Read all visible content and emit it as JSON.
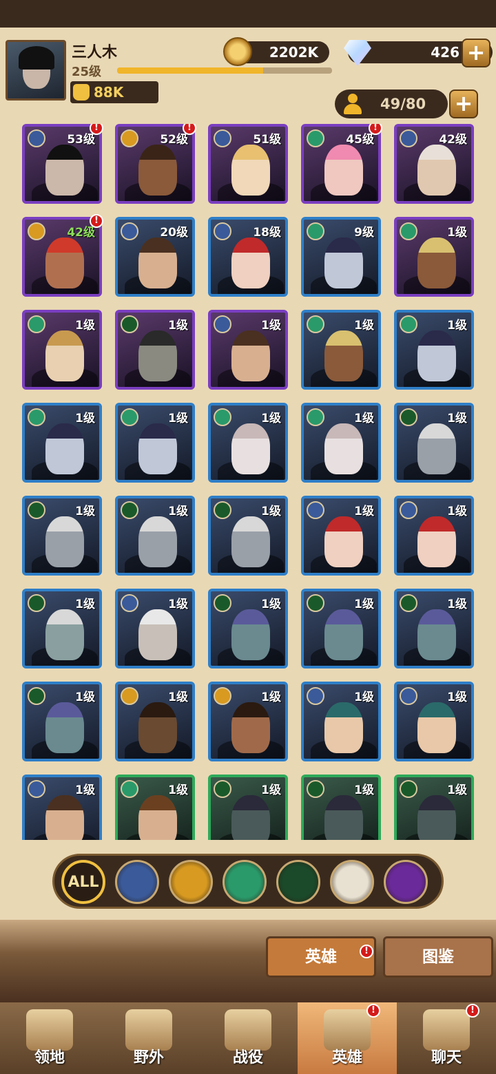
{
  "player": {
    "name": "三人木",
    "level": "25级",
    "xp_fraction": 0.68,
    "power": "88K"
  },
  "currency": {
    "gold": "2202K",
    "gems": "426"
  },
  "roster": {
    "count": "49/80"
  },
  "heroes": [
    {
      "level": "53级",
      "rarity": "purple",
      "faction": "sun",
      "alert": true,
      "skin": "#cbb8aa",
      "hair": "#111"
    },
    {
      "level": "52级",
      "rarity": "purple",
      "faction": "light",
      "alert": true,
      "skin": "#8a5a3a",
      "hair": "#3a2418"
    },
    {
      "level": "51级",
      "rarity": "purple",
      "faction": "sun",
      "alert": false,
      "skin": "#f0d8b8",
      "hair": "#e8c070"
    },
    {
      "level": "45级",
      "rarity": "purple",
      "faction": "nature",
      "alert": true,
      "skin": "#f0c8c0",
      "hair": "#f08ab0"
    },
    {
      "level": "42级",
      "rarity": "purple",
      "faction": "sun",
      "alert": false,
      "skin": "#e0c8b0",
      "hair": "#e8e0d8"
    },
    {
      "level": "42级",
      "rarity": "purple",
      "faction": "light",
      "alert": true,
      "skin": "#b07050",
      "hair": "#d03a2a",
      "green_level": true
    },
    {
      "level": "20级",
      "rarity": "blue",
      "faction": "sun",
      "alert": false,
      "skin": "#d8b090",
      "hair": "#4a3020"
    },
    {
      "level": "18级",
      "rarity": "blue",
      "faction": "sun",
      "alert": false,
      "skin": "#f0d0c0",
      "hair": "#c02a2a"
    },
    {
      "level": "9级",
      "rarity": "blue",
      "faction": "nature",
      "alert": false,
      "skin": "#c0c8d8",
      "hair": "#2a2a4a"
    },
    {
      "level": "1级",
      "rarity": "purple",
      "faction": "nature",
      "alert": false,
      "skin": "#8a5a3a",
      "hair": "#d8c070"
    },
    {
      "level": "1级",
      "rarity": "purple",
      "faction": "nature",
      "alert": false,
      "skin": "#e8d0b0",
      "hair": "#c89a50"
    },
    {
      "level": "1级",
      "rarity": "purple",
      "faction": "dark",
      "alert": false,
      "skin": "#8a8a80",
      "hair": "#2a2a2a"
    },
    {
      "level": "1级",
      "rarity": "purple",
      "faction": "sun",
      "alert": false,
      "skin": "#d8b090",
      "hair": "#4a3020"
    },
    {
      "level": "1级",
      "rarity": "blue",
      "faction": "nature",
      "alert": false,
      "skin": "#8a5a3a",
      "hair": "#d8c070"
    },
    {
      "level": "1级",
      "rarity": "blue",
      "faction": "nature",
      "alert": false,
      "skin": "#c0c8d8",
      "hair": "#2a2a4a"
    },
    {
      "level": "1级",
      "rarity": "blue",
      "faction": "nature",
      "alert": false,
      "skin": "#c0c8d8",
      "hair": "#2a2a4a"
    },
    {
      "level": "1级",
      "rarity": "blue",
      "faction": "nature",
      "alert": false,
      "skin": "#c0c8d8",
      "hair": "#2a2a4a"
    },
    {
      "level": "1级",
      "rarity": "blue",
      "faction": "nature",
      "alert": false,
      "skin": "#e8e0e0",
      "hair": "#c8b8b8"
    },
    {
      "level": "1级",
      "rarity": "blue",
      "faction": "nature",
      "alert": false,
      "skin": "#e8e0e0",
      "hair": "#c8b8b8"
    },
    {
      "level": "1级",
      "rarity": "blue",
      "faction": "dark",
      "alert": false,
      "skin": "#9aa0a8",
      "hair": "#d8d8d8"
    },
    {
      "level": "1级",
      "rarity": "blue",
      "faction": "dark",
      "alert": false,
      "skin": "#9aa0a8",
      "hair": "#d8d8d8"
    },
    {
      "level": "1级",
      "rarity": "blue",
      "faction": "dark",
      "alert": false,
      "skin": "#9aa0a8",
      "hair": "#d8d8d8"
    },
    {
      "level": "1级",
      "rarity": "blue",
      "faction": "dark",
      "alert": false,
      "skin": "#9aa0a8",
      "hair": "#d8d8d8"
    },
    {
      "level": "1级",
      "rarity": "blue",
      "faction": "sun",
      "alert": false,
      "skin": "#f0d0c0",
      "hair": "#c02a2a"
    },
    {
      "level": "1级",
      "rarity": "blue",
      "faction": "sun",
      "alert": false,
      "skin": "#f0d0c0",
      "hair": "#c02a2a"
    },
    {
      "level": "1级",
      "rarity": "blue",
      "faction": "dark",
      "alert": false,
      "skin": "#8aa0a0",
      "hair": "#d8d8d8"
    },
    {
      "level": "1级",
      "rarity": "blue",
      "faction": "sun",
      "alert": false,
      "skin": "#c8c0b8",
      "hair": "#e8e8e8"
    },
    {
      "level": "1级",
      "rarity": "blue",
      "faction": "dark",
      "alert": false,
      "skin": "#6a8a90",
      "hair": "#5a5a9a"
    },
    {
      "level": "1级",
      "rarity": "blue",
      "faction": "dark",
      "alert": false,
      "skin": "#6a8a90",
      "hair": "#5a5a9a"
    },
    {
      "level": "1级",
      "rarity": "blue",
      "faction": "dark",
      "alert": false,
      "skin": "#6a8a90",
      "hair": "#5a5a9a"
    },
    {
      "level": "1级",
      "rarity": "blue",
      "faction": "dark",
      "alert": false,
      "skin": "#6a8a90",
      "hair": "#5a5a9a"
    },
    {
      "level": "1级",
      "rarity": "blue",
      "faction": "light",
      "alert": false,
      "skin": "#6a4a30",
      "hair": "#2a1a10"
    },
    {
      "level": "1级",
      "rarity": "blue",
      "faction": "light",
      "alert": false,
      "skin": "#a06a4a",
      "hair": "#2a1a10"
    },
    {
      "level": "1级",
      "rarity": "blue",
      "faction": "sun",
      "alert": false,
      "skin": "#e8c8a8",
      "hair": "#2a6a6a"
    },
    {
      "level": "1级",
      "rarity": "blue",
      "faction": "sun",
      "alert": false,
      "skin": "#e8c8a8",
      "hair": "#2a6a6a"
    },
    {
      "level": "1级",
      "rarity": "blue",
      "faction": "sun",
      "alert": false,
      "skin": "#d8b090",
      "hair": "#4a3020"
    },
    {
      "level": "1级",
      "rarity": "green",
      "faction": "nature",
      "alert": false,
      "skin": "#d8b090",
      "hair": "#6a4020"
    },
    {
      "level": "1级",
      "rarity": "green",
      "faction": "dark",
      "alert": false,
      "skin": "#4a5a5a",
      "hair": "#2a2a3a"
    },
    {
      "level": "1级",
      "rarity": "green",
      "faction": "dark",
      "alert": false,
      "skin": "#4a5a5a",
      "hair": "#2a2a3a"
    },
    {
      "level": "1级",
      "rarity": "green",
      "faction": "dark",
      "alert": false,
      "skin": "#4a5a5a",
      "hair": "#2a2a3a"
    }
  ],
  "faction_colors": {
    "sun": "#3a5a9a",
    "light": "#d89a20",
    "nature": "#2a9a6a",
    "dark": "#1a5a2a"
  },
  "filters": [
    {
      "name": "all",
      "label": "ALL",
      "active": true,
      "color": "#2a1e14"
    },
    {
      "name": "sun",
      "color": "#3a5a9a"
    },
    {
      "name": "light",
      "color": "#d89a20"
    },
    {
      "name": "nature",
      "color": "#2a9a6a"
    },
    {
      "name": "dark",
      "color": "#1a4a2a"
    },
    {
      "name": "celestial",
      "color": "#e8e0d0"
    },
    {
      "name": "hypogean",
      "color": "#6a2a9a"
    }
  ],
  "sub_tabs": [
    {
      "label": "英雄",
      "active": true,
      "alert": true
    },
    {
      "label": "图鉴",
      "active": false,
      "alert": false
    }
  ],
  "nav": [
    {
      "label": "领地",
      "icon": "castle-icon",
      "active": false,
      "alert": false
    },
    {
      "label": "野外",
      "icon": "map-scroll-icon",
      "active": false,
      "alert": false
    },
    {
      "label": "战役",
      "icon": "sword-shield-icon",
      "active": false,
      "alert": false
    },
    {
      "label": "英雄",
      "icon": "helmet-icon",
      "active": true,
      "alert": true
    },
    {
      "label": "聊天",
      "icon": "chat-icon",
      "active": false,
      "alert": true
    }
  ],
  "alert_glyph": "!"
}
